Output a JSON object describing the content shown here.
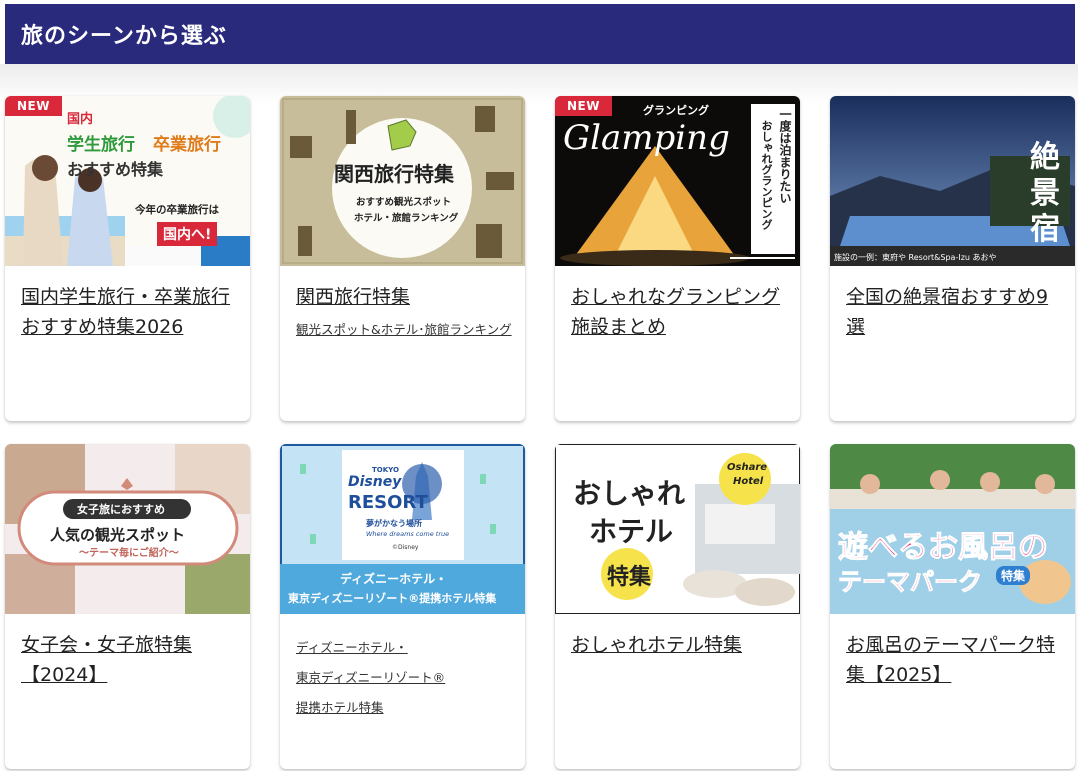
{
  "header": {
    "title": "旅のシーンから選ぶ"
  },
  "badge": "NEW",
  "cards": [
    {
      "title": "国内学生旅行・卒業旅行おすすめ特集2026",
      "img": {
        "l1": "国内",
        "l2a": "学生旅行",
        "l2b": "卒業旅行",
        "l3": "おすすめ特集",
        "l4": "今年の卒業旅行は",
        "l5": "国内へ!"
      }
    },
    {
      "title": "関西旅行特集",
      "sub": "観光スポット&ホテル･旅館ランキング",
      "img": {
        "l1": "関西旅行特集",
        "l2": "おすすめ観光スポット",
        "l3": "ホテル・旅館ランキング"
      }
    },
    {
      "title": "おしゃれなグランピング施設まとめ",
      "img": {
        "l1": "グランピング",
        "l2": "Glamping",
        "v1": "一度は泊まりたい",
        "v2": "おしゃれグランピング"
      }
    },
    {
      "title": "全国の絶景宿おすすめ9選",
      "img": {
        "l1": "絶",
        "l2": "景",
        "l3": "宿",
        "cap": "施設の一例：東府や Resort&Spa-Izu あおや"
      }
    },
    {
      "title": "女子会・女子旅特集【2024】",
      "img": {
        "l1": "女子旅におすすめ",
        "l2": "人気の観光スポット",
        "l3": "〜テーマ毎にご紹介〜"
      }
    },
    {
      "title": "",
      "sub_lines": [
        "ディズニーホテル・",
        "東京ディズニーリゾート®",
        "提携ホテル特集"
      ],
      "img": {
        "t1": "TOKYO",
        "t2": "Disney",
        "t3": "RESORT",
        "t4": "夢がかなう場所",
        "t5": "Where dreams come true",
        "t6": "©Disney",
        "b1": "ディズニーホテル・",
        "b2": "東京ディズニーリゾート®提携ホテル特集"
      }
    },
    {
      "title": "おしゃれホテル特集",
      "img": {
        "l1": "おしゃれ",
        "l2": "ホテル",
        "l3": "特集",
        "tag1": "Oshare",
        "tag2": "Hotel"
      }
    },
    {
      "title": "お風呂のテーマパーク特集【2025】",
      "img": {
        "l1": "遊べるお風呂の",
        "l2": "テーマパーク",
        "l3": "特集"
      }
    }
  ],
  "colors": {
    "header_bg": "#2a2a7d",
    "badge": "#d8283a",
    "kansai_bg": "#c8bd9a"
  }
}
